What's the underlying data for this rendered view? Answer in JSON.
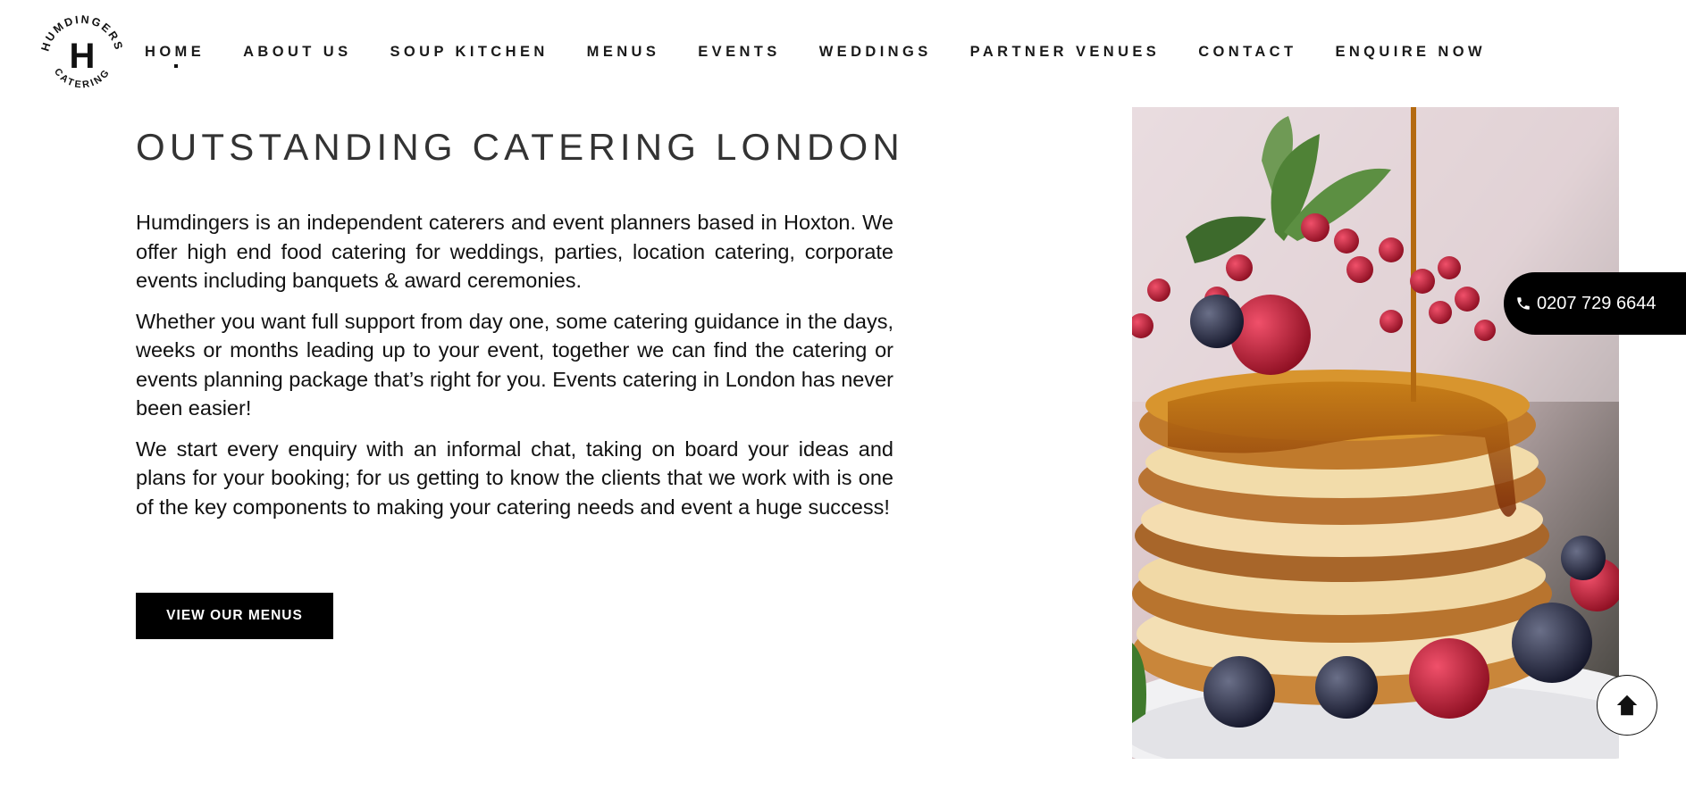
{
  "brand": {
    "logo_letter": "H",
    "logo_top_text": "HUMDINGERS",
    "logo_bottom_text": "CATERING"
  },
  "nav": {
    "items": [
      {
        "label": "HOME"
      },
      {
        "label": "ABOUT US"
      },
      {
        "label": "SOUP KITCHEN"
      },
      {
        "label": "MENUS"
      },
      {
        "label": "EVENTS"
      },
      {
        "label": "WEDDINGS"
      },
      {
        "label": "PARTNER VENUES"
      },
      {
        "label": "CONTACT"
      },
      {
        "label": "ENQUIRE NOW"
      }
    ],
    "active_index": 0
  },
  "main": {
    "title": "OUTSTANDING CATERING LONDON",
    "paragraphs": [
      "Humdingers is an independent caterers and event planners based in Hoxton. We offer high end food catering for weddings, parties, location catering, corporate events including banquets & award ceremonies.",
      "Whether you want full support from day one, some catering guidance in the days, weeks or months leading up to your event, together we can find the catering or events planning package that’s right for you. Events catering in London has never been easier!",
      "We start every enquiry with an informal chat, taking on board your ideas and plans for your booking; for us getting to know the clients that we work with is one of the key components to making your catering needs and event a huge success!"
    ],
    "cta_label": "VIEW OUR MENUS"
  },
  "floating": {
    "phone": "0207 729 6644",
    "phone_icon": "phone-icon",
    "back_to_top_icon": "arrow-up-icon"
  },
  "colors": {
    "background": "#ffffff",
    "text": "#111111",
    "title": "#333333",
    "button_bg": "#000000",
    "button_text": "#ffffff"
  }
}
